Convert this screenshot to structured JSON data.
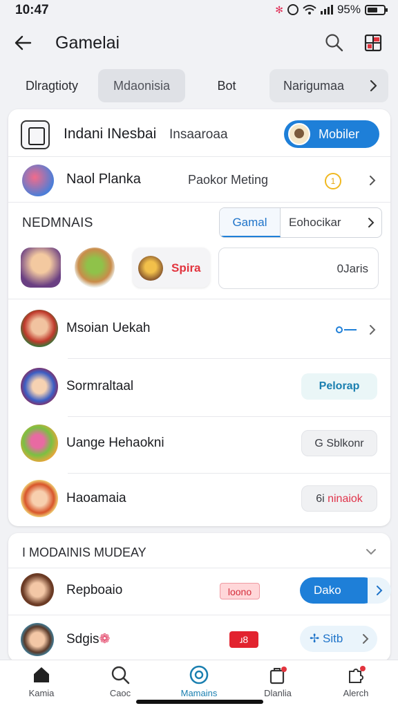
{
  "status": {
    "time": "10:47",
    "battery": "95%",
    "bluetooth": "✻"
  },
  "header": {
    "title": "Gamelai"
  },
  "tabs": [
    {
      "label": "Dlragtioty"
    },
    {
      "label": "Mdaonisia"
    },
    {
      "label": "Bot"
    },
    {
      "label": "Narigumaa"
    }
  ],
  "profile": {
    "name": "Indani INesbai",
    "sub": "Insaaroaa",
    "button_label": "Mobiler"
  },
  "nav_row": {
    "name": "Naol Planka",
    "meta": "Paokor Meting",
    "coin": "1"
  },
  "section": {
    "title": "NEDMNAIS",
    "seg_active": "Gamal",
    "seg_other": "Eohocikar",
    "chip_label": "Spira",
    "search_text": "0Jaris"
  },
  "list": [
    {
      "name": "Msoian Uekah",
      "badge": ""
    },
    {
      "name": "Sormraltaal",
      "badge": "Pelorap"
    },
    {
      "name": "Uange Hehaokni",
      "badge": "G Sblkonr"
    },
    {
      "name": "Haoamaia",
      "badge_a": "6i",
      "badge_b": "ninaiok"
    }
  ],
  "card2": {
    "title": "I MODAINIS MUDEAY",
    "rows": [
      {
        "name": "Repboaio",
        "tag": "loono",
        "action": "Dako"
      },
      {
        "name": "Sdgis",
        "emoji": "❁",
        "tag": "ɹ8",
        "action": "Sitb",
        "action_icon": "✢"
      }
    ]
  },
  "bottom_nav": [
    {
      "label": "Kamia",
      "icon": "home-icon"
    },
    {
      "label": "Caoc",
      "icon": "search-icon"
    },
    {
      "label": "Mamains",
      "icon": "compass-icon"
    },
    {
      "label": "Dlanlia",
      "icon": "bag-icon"
    },
    {
      "label": "Alerch",
      "icon": "puzzle-icon"
    }
  ],
  "colors": {
    "accent": "#1e7fd8",
    "red": "#e2232f",
    "teal": "#1a7fb0"
  }
}
